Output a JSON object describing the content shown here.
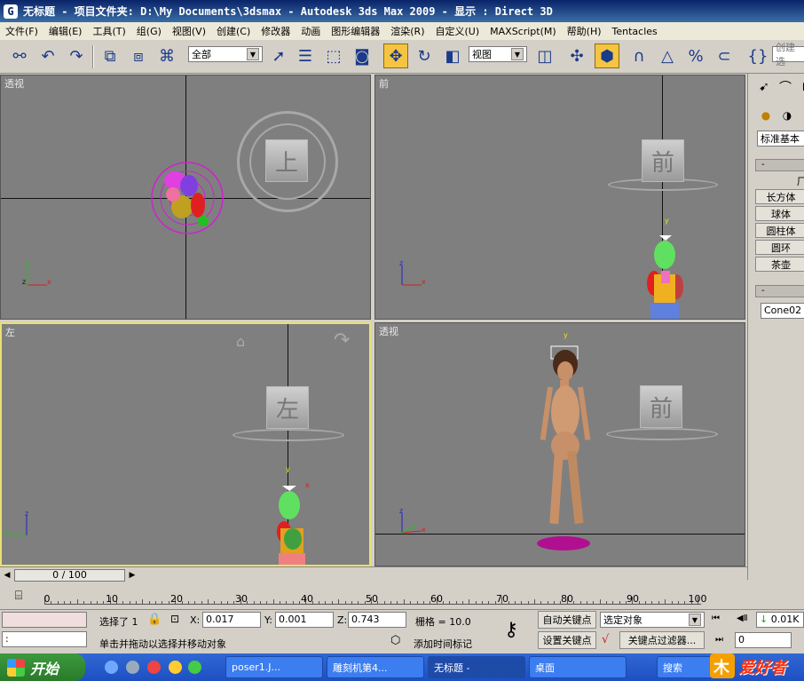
{
  "window": {
    "title": "无标题    - 项目文件夹: D:\\My Documents\\3dsmax    - Autodesk 3ds Max  2009    - 显示 : Direct 3D"
  },
  "menu": [
    "文件(F)",
    "编辑(E)",
    "工具(T)",
    "组(G)",
    "视图(V)",
    "创建(C)",
    "修改器",
    "动画",
    "图形编辑器",
    "渲染(R)",
    "自定义(U)",
    "MAXScript(M)",
    "帮助(H)",
    "Tentacles"
  ],
  "toolbar": {
    "selection_filter": "全部",
    "reference_coord": "视图",
    "named_selection_placeholder": "创建选"
  },
  "viewports": {
    "top_left": {
      "label": "透视",
      "cube": "上"
    },
    "top_right": {
      "label": "前",
      "cube": "前"
    },
    "bottom_left": {
      "label": "左",
      "cube": "左"
    },
    "bottom_right": {
      "label": "透视",
      "cube": "前"
    }
  },
  "command_panel": {
    "category": "标准基本",
    "rollout_object_type": "-",
    "autogrid": "厂",
    "objects": [
      "长方体",
      "球体",
      "圆柱体",
      "圆环",
      "茶壶"
    ],
    "rollout_name": "-",
    "object_name": "Cone02"
  },
  "timeline": {
    "frame_display": "0 / 100",
    "current": 0,
    "total": 100,
    "ticks": [
      "0",
      "10",
      "20",
      "30",
      "40",
      "50",
      "60",
      "70",
      "80",
      "90",
      "100"
    ]
  },
  "status": {
    "selected": "选择了 1",
    "x_label": "X:",
    "x_value": "0.017",
    "y_label": "Y:",
    "y_value": "0.001",
    "z_label": "Z:",
    "z_value": "0.743",
    "grid": "栅格 = 10.0",
    "auto_key": "自动关键点",
    "set_key": "设置关键点",
    "key_mode": "选定对象",
    "key_filter": "关键点过滤器...",
    "prompt": "单击并拖动以选择并移动对象",
    "add_time_tag": "添加时间标记",
    "script_listener": ":",
    "frame_field": "0",
    "time_config": "0.01K"
  },
  "taskbar": {
    "start": "开始",
    "tasks": [
      "poser1.J...",
      "雕刻机第4...",
      "无标题 -",
      "桌面",
      "搜索"
    ]
  },
  "watermark": "爱好者",
  "colors": {
    "viewport_bg": "#7f7f7f",
    "active_border": "#e8e070",
    "selected_tool": "#f5c542",
    "taskbar": "#245edb"
  }
}
